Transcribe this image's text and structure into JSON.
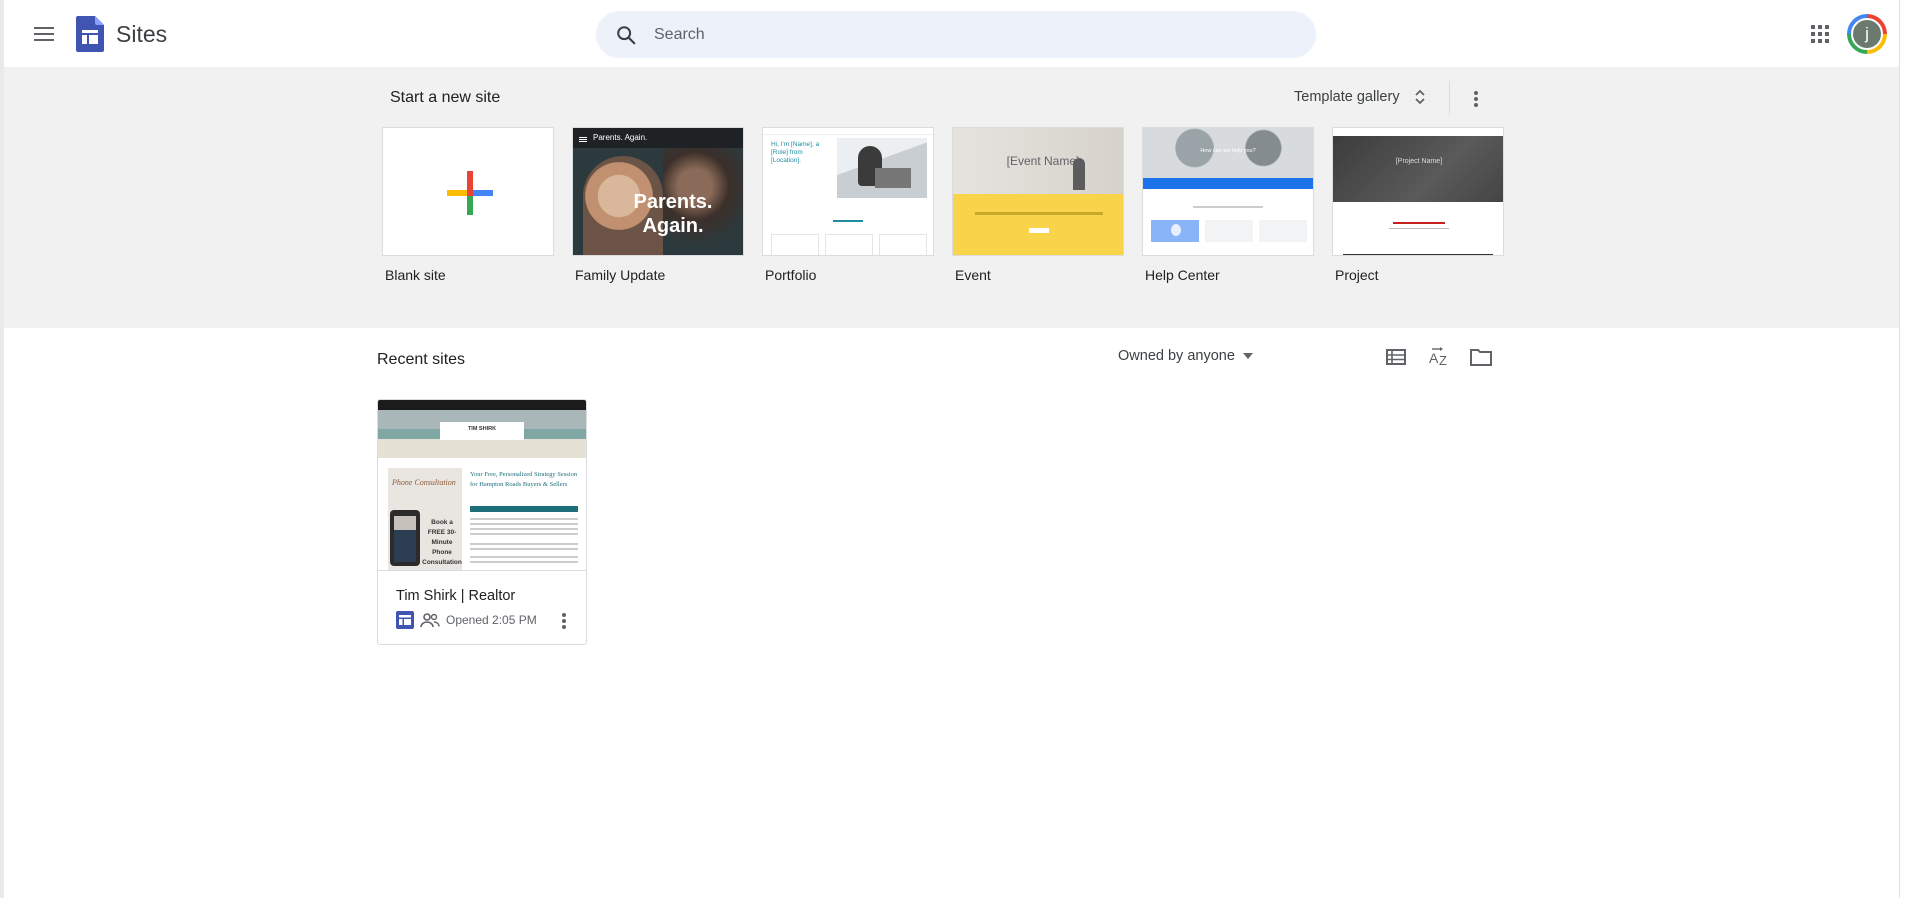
{
  "app": {
    "title": "Sites"
  },
  "search": {
    "placeholder": "Search"
  },
  "avatar": {
    "initial": "j"
  },
  "templates": {
    "heading": "Start a new site",
    "gallery_label": "Template gallery",
    "items": [
      {
        "label": "Blank site"
      },
      {
        "label": "Family Update",
        "thumb_text": "Parents. Again.",
        "thumb_header": "Parents. Again."
      },
      {
        "label": "Portfolio",
        "thumb_text": "Hi, I'm [Name], a [Role] from [Location]."
      },
      {
        "label": "Event",
        "thumb_text": "[Event Name]"
      },
      {
        "label": "Help Center",
        "thumb_text": "How can we help you?"
      },
      {
        "label": "Project",
        "thumb_text": "[Project Name]"
      }
    ]
  },
  "recent": {
    "heading": "Recent sites",
    "owner_filter": "Owned by anyone",
    "sites": [
      {
        "title": "Tim Shirk | Realtor",
        "opened": "Opened 2:05 PM",
        "thumb_name": "TIM SHIRK",
        "thumb_headline": "Your Free, Personalized Strategy Session for Hampton Roads Buyers & Sellers",
        "thumb_promo": "Book a FREE 30-Minute Phone Consultation",
        "thumb_script": "Phone Consultation"
      }
    ]
  },
  "colors": {
    "accent_blue": "#4285f4",
    "event_yellow": "#f9d349",
    "help_blue": "#1a73e8"
  }
}
